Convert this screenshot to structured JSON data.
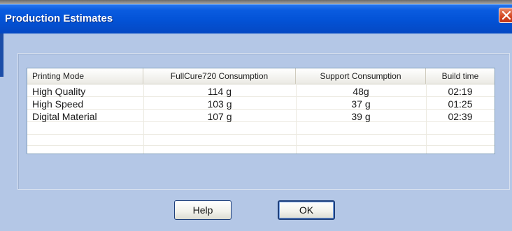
{
  "window": {
    "title": "Production Estimates",
    "close_icon": "close-icon"
  },
  "table": {
    "columns": [
      "Printing Mode",
      "FullCure720 Consumption",
      "Support Consumption",
      "Build time"
    ],
    "rows": [
      [
        "High Quality",
        "114 g",
        "48g",
        "02:19"
      ],
      [
        "High Speed",
        "103 g",
        "37 g",
        "01:25"
      ],
      [
        "Digital Material",
        "107 g",
        "39 g",
        "02:39"
      ]
    ]
  },
  "buttons": {
    "help_label": "Help",
    "ok_label": "OK"
  },
  "colors": {
    "titlebar": "#0352d6",
    "dialog_background": "#b4c7e6",
    "close_button": "#d2451f"
  }
}
